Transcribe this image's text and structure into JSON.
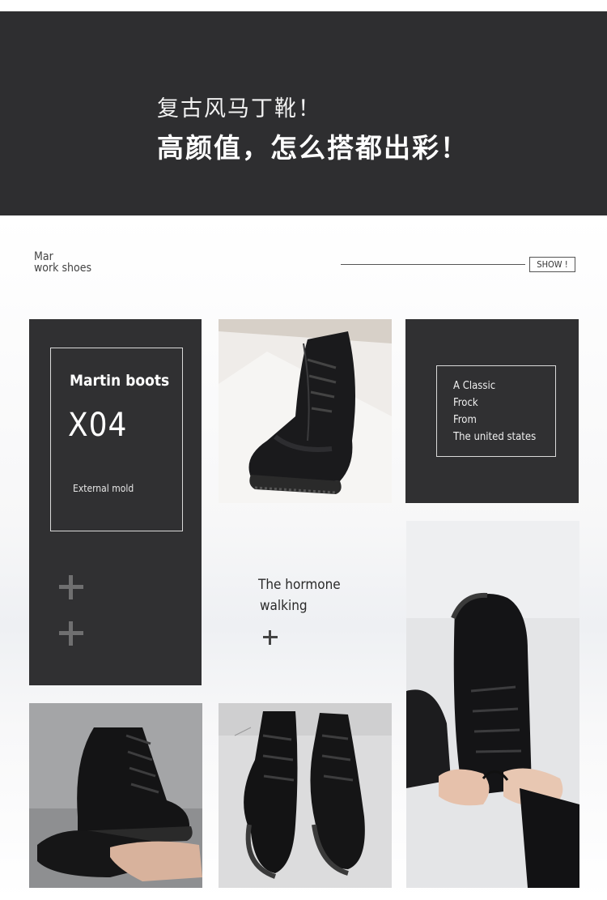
{
  "banner": {
    "line1": "复古风马丁靴！",
    "line2": "高颜值，怎么搭都出彩！"
  },
  "section": {
    "subtitle_line1": "Mar",
    "subtitle_line2": "work shoes",
    "show_label": "SHOW !"
  },
  "card_left": {
    "title": "Martin boots",
    "code": "X04",
    "caption": "External mold"
  },
  "card_right": {
    "lines": [
      "A Classic",
      "Frock",
      "From",
      "The united states"
    ]
  },
  "center_text": {
    "line1": "The hormone",
    "line2": "walking"
  },
  "photos": {
    "top_center": "boot-on-white-paper",
    "right_tall": "hands-tying-boot-laces",
    "bottom_left": "hand-holding-boots",
    "bottom_center": "pair-of-boots-top-view"
  },
  "colors": {
    "banner_bg": "#2e2e30",
    "card_bg": "#303032",
    "text_light": "#ffffff"
  }
}
